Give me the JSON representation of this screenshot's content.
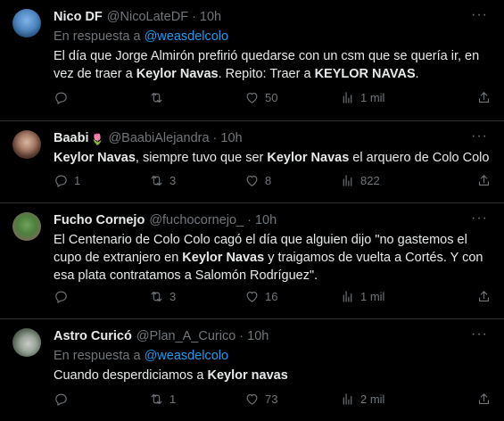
{
  "tweets": [
    {
      "name": "Nico DF",
      "handle": "@NicoLateDF",
      "time": "10h",
      "reply_prefix": "En respuesta a",
      "reply_to": "@weasdelcolo",
      "text_parts": [
        {
          "t": "El día que Jorge Almirón prefirió quedarse con un csm que se quería ir, en vez de traer a ",
          "b": false
        },
        {
          "t": "Keylor Navas",
          "b": true
        },
        {
          "t": ". Repito: Traer a ",
          "b": false
        },
        {
          "t": "KEYLOR NAVAS",
          "b": true
        },
        {
          "t": ".",
          "b": false
        }
      ],
      "replies": "",
      "retweets": "",
      "likes": "50",
      "views": "1 mil"
    },
    {
      "name": "Baabi",
      "name_emoji": "🌷",
      "handle": "@BaabiAlejandra",
      "time": "10h",
      "text_parts": [
        {
          "t": "Keylor Navas",
          "b": true
        },
        {
          "t": ", siempre tuvo que ser ",
          "b": false
        },
        {
          "t": "Keylor Navas",
          "b": true
        },
        {
          "t": " el arquero de Colo Colo",
          "b": false
        }
      ],
      "replies": "1",
      "retweets": "3",
      "likes": "8",
      "views": "822"
    },
    {
      "name": "Fucho Cornejo",
      "handle": "@fuchocornejo_",
      "time": "10h",
      "text_parts": [
        {
          "t": "El Centenario de Colo Colo cagó el día que alguien dijo \"no gastemos el cupo de extranjero en ",
          "b": false
        },
        {
          "t": "Keylor Navas",
          "b": true
        },
        {
          "t": " y traigamos de vuelta a Cortés. Y con esa plata contratamos a Salomón Rodríguez\".",
          "b": false
        }
      ],
      "replies": "",
      "retweets": "3",
      "likes": "16",
      "views": "1 mil"
    },
    {
      "name": "Astro Curicó",
      "handle": "@Plan_A_Curico",
      "time": "10h",
      "reply_prefix": "En respuesta a",
      "reply_to": "@weasdelcolo",
      "text_parts": [
        {
          "t": "Cuando desperdiciamos a ",
          "b": false
        },
        {
          "t": "Keylor navas",
          "b": true
        }
      ],
      "replies": "",
      "retweets": "1",
      "likes": "73",
      "views": "2 mil"
    }
  ],
  "icons": {
    "reply": "reply-icon",
    "retweet": "retweet-icon",
    "like": "heart-icon",
    "views": "views-chart-icon",
    "share": "share-icon",
    "more": "more-icon"
  },
  "colors": {
    "background": "#000000",
    "text": "#e7e9ea",
    "muted": "#71767b",
    "link": "#1d9bf0",
    "divider": "#2f3336"
  }
}
